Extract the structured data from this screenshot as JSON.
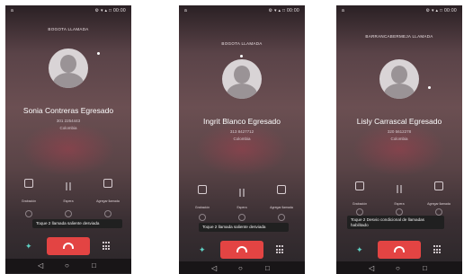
{
  "screens": [
    {
      "status_left": "a",
      "status_right": "⚙ ▾ ▴ □ 00:00",
      "header": "BOGOTA LLAMADA",
      "caller_name": "Sonia Contreras Egresado",
      "caller_number": "301 2254443",
      "caller_location": "Colombia",
      "actions": [
        "Grabación",
        "Espera",
        "Agregar llamada"
      ],
      "toast": "Toque 2 llamada saliente desviada",
      "nav": [
        "◁",
        "○",
        "□"
      ]
    },
    {
      "status_left": "a",
      "status_right": "⚙ ▾ ▴ □ 00:00",
      "header": "BOGOTA LLAMADA",
      "caller_name": "Ingrit Blanco Egresado",
      "caller_number": "313 8427712",
      "caller_location": "Colombia",
      "actions": [
        "Grabación",
        "Espera",
        "Agregar llamada"
      ],
      "toast": "Toque 2 llamada saliente desviada",
      "nav": [
        "◁",
        "○",
        "□"
      ]
    },
    {
      "status_left": "a",
      "status_right": "⚙ ▾ ▴ □ 00:00",
      "header": "BARRANCABERMEJA LLAMADA",
      "caller_name": "Lisly Carrascal Egresado",
      "caller_number": "320 5612278",
      "caller_location": "Colombia",
      "actions": [
        "Grabación",
        "Espera",
        "Agregar llamada"
      ],
      "toast": "Toque 2 Desvio condicional de llamadas habilitado",
      "nav": [
        "◁",
        "○",
        "□"
      ]
    }
  ]
}
